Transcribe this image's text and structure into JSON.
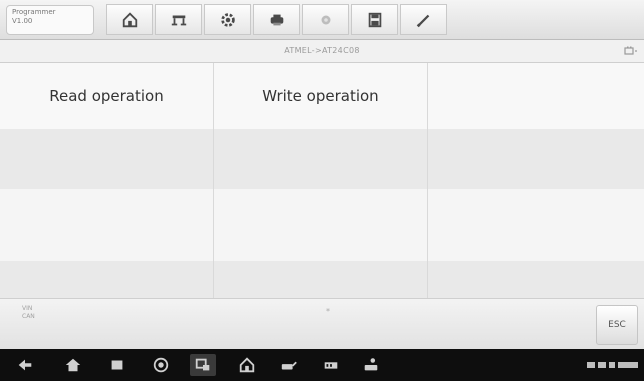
{
  "app": {
    "name": "Programmer",
    "version": "V1.00"
  },
  "toolbar": {
    "buttons": [
      {
        "icon": "home-icon"
      },
      {
        "icon": "vehicle-swap-icon"
      },
      {
        "icon": "settings-icon"
      },
      {
        "icon": "print-icon"
      },
      {
        "icon": "help-icon"
      },
      {
        "icon": "save-icon"
      },
      {
        "icon": "data-logging-icon"
      }
    ]
  },
  "subheader": {
    "chip_name": "ATMEL->AT24C08",
    "icon": "battery-voltage-icon"
  },
  "functions": {
    "read_label": "Read operation",
    "write_label": "Write operation"
  },
  "footer": {
    "info_line1": "VIN",
    "info_line2": "CAN",
    "center_mark": "*",
    "esc_label": "ESC"
  },
  "navbar": {
    "icons": [
      "back-icon",
      "home-icon",
      "recents-icon",
      "chrome-icon",
      "screenshot-icon",
      "maxifix-home-icon",
      "vci-icon",
      "vcmi-icon",
      "car-wifi-icon"
    ],
    "status": "signal-wifi-battery-clock"
  },
  "colors": {
    "accent": "#cc2233",
    "toolbar_icon": "#4a4a4a",
    "nav_icon": "#d0d0d0",
    "row_light": "#f5f5f5",
    "row_dark": "#e9e9e9"
  }
}
